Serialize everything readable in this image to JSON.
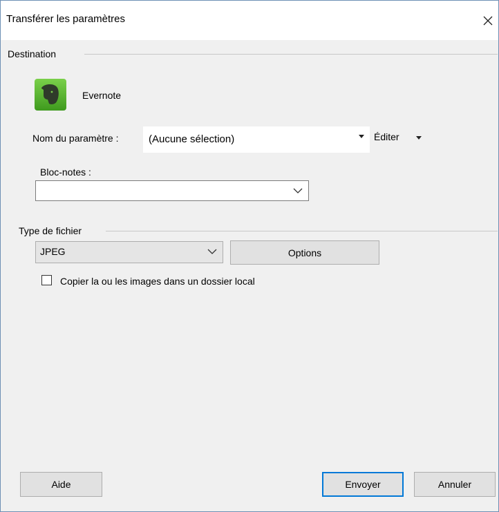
{
  "window": {
    "title": "Transférer les paramètres"
  },
  "destination": {
    "group_label": "Destination",
    "app_name": "Evernote",
    "app_icon": "evernote-elephant-icon",
    "setting_name_label": "Nom du paramètre :",
    "setting_name_value": "(Aucune sélection)",
    "edit_label": "Éditer",
    "notebook_label": "Bloc-notes :",
    "notebook_value": ""
  },
  "file_type": {
    "group_label": "Type de fichier",
    "value": "JPEG",
    "options_button": "Options",
    "copy_local_label": "Copier la ou les images dans un dossier local",
    "copy_local_checked": false
  },
  "footer": {
    "help_button": "Aide",
    "send_button": "Envoyer",
    "cancel_button": "Annuler"
  },
  "colors": {
    "accent": "#0078d7",
    "icon_green": "#5cb82e"
  }
}
